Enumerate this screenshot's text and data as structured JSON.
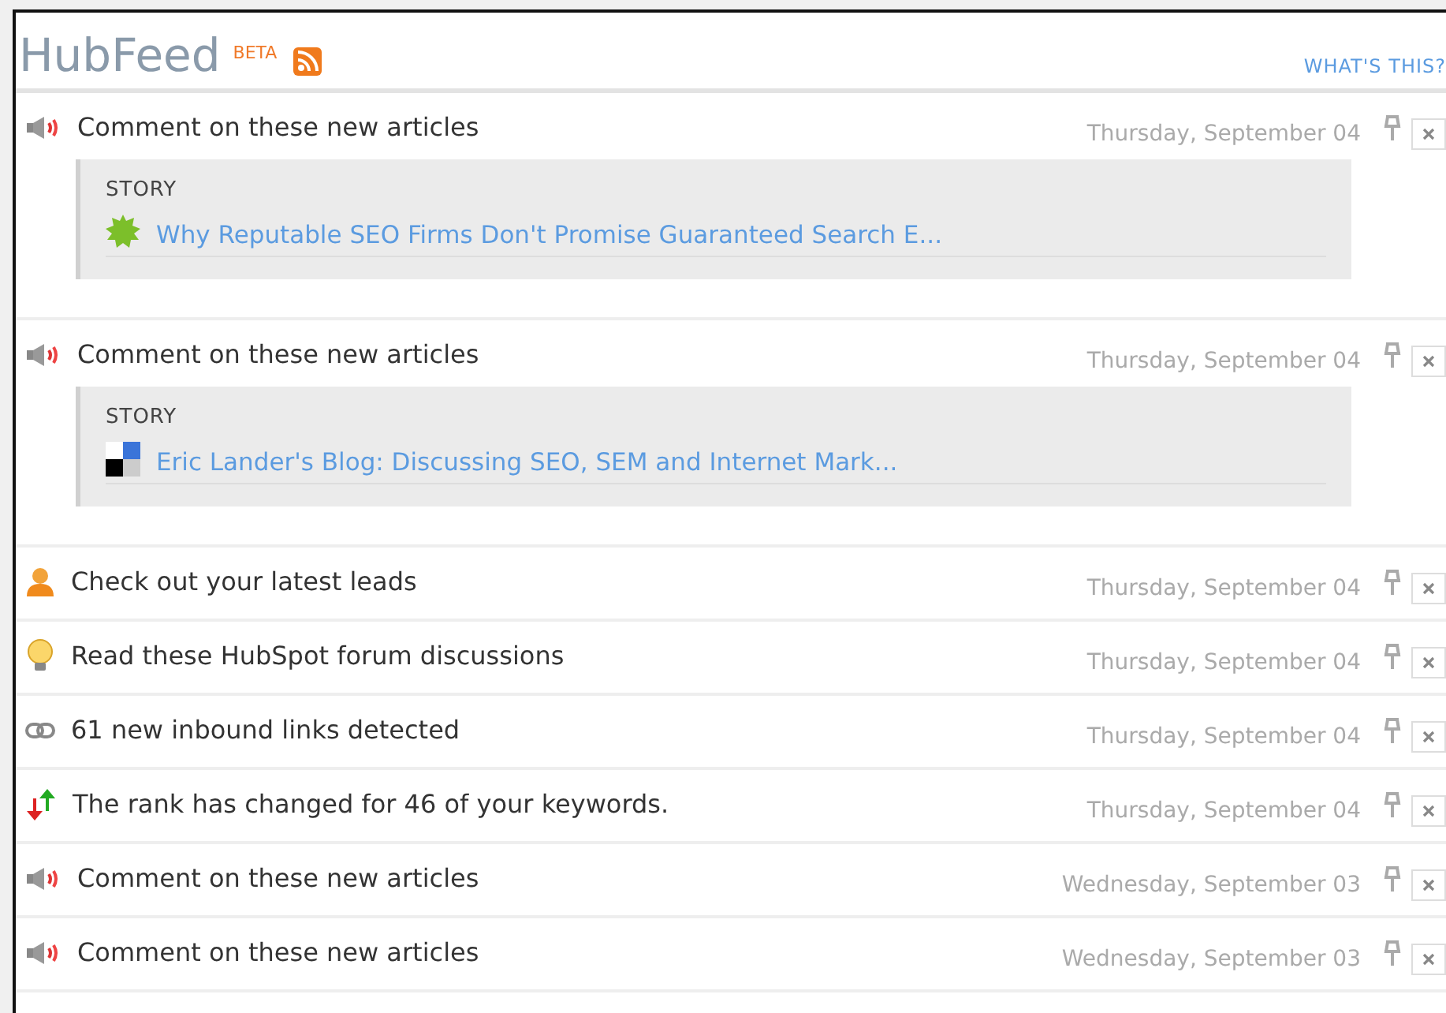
{
  "header": {
    "title": "HubFeed",
    "badge": "BETA",
    "help_link": "WHAT'S THIS?"
  },
  "feed": [
    {
      "kind": "megaphone",
      "text": "Comment on these new articles",
      "date": "Thursday, September 04",
      "story": {
        "label": "STORY",
        "kind": "gear",
        "link": "Why Reputable SEO Firms Don't Promise Guaranteed Search E..."
      }
    },
    {
      "kind": "megaphone",
      "text": "Comment on these new articles",
      "date": "Thursday, September 04",
      "story": {
        "label": "STORY",
        "kind": "squares",
        "link": "Eric Lander's Blog: Discussing SEO, SEM and Internet Mark..."
      }
    },
    {
      "kind": "person",
      "text": "Check out your latest leads",
      "date": "Thursday, September 04"
    },
    {
      "kind": "bulb",
      "text": "Read these HubSpot forum discussions",
      "date": "Thursday, September 04"
    },
    {
      "kind": "chain",
      "text": "61 new inbound links detected",
      "date": "Thursday, September 04"
    },
    {
      "kind": "arrows",
      "text": "The rank has changed for 46 of your keywords.",
      "date": "Thursday, September 04"
    },
    {
      "kind": "megaphone",
      "text": "Comment on these new articles",
      "date": "Wednesday, September 03"
    },
    {
      "kind": "megaphone",
      "text": "Comment on these new articles",
      "date": "Wednesday, September 03"
    }
  ]
}
